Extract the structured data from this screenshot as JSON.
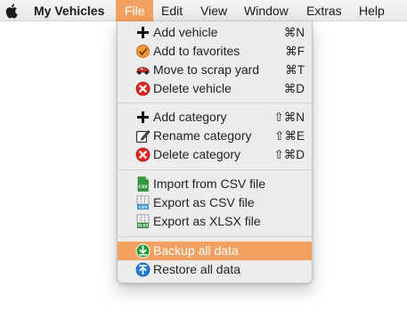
{
  "menubar": {
    "apple_icon": "apple-logo-icon",
    "app_name": "My Vehicles",
    "menus": [
      "File",
      "Edit",
      "View",
      "Window",
      "Extras",
      "Help"
    ],
    "active_menu": "File",
    "highlight_color": "#f3a160"
  },
  "file_menu": {
    "vehicle_group": [
      {
        "label": "Add vehicle",
        "shortcut": "⌘N",
        "icon": "plus-icon"
      },
      {
        "label": "Add to favorites",
        "shortcut": "⌘F",
        "icon": "favorite-check-icon"
      },
      {
        "label": "Move to scrap yard",
        "shortcut": "⌘T",
        "icon": "scrap-car-icon"
      },
      {
        "label": "Delete vehicle",
        "shortcut": "⌘D",
        "icon": "delete-red-icon"
      }
    ],
    "category_group": [
      {
        "label": "Add category",
        "shortcut": "⇧⌘N",
        "icon": "plus-icon"
      },
      {
        "label": "Rename category",
        "shortcut": "⇧⌘E",
        "icon": "rename-pencil-icon"
      },
      {
        "label": "Delete category",
        "shortcut": "⇧⌘D",
        "icon": "delete-red-icon"
      }
    ],
    "file_group": [
      {
        "label": "Import from CSV file",
        "icon": "csv-file-icon",
        "icon_text": "CSV"
      },
      {
        "label": "Export as CSV file",
        "icon": "csv-table-icon",
        "icon_text": "CSV"
      },
      {
        "label": "Export as XLSX file",
        "icon": "xlsx-table-icon",
        "icon_text": "XLSX"
      }
    ],
    "data_group": [
      {
        "label": "Backup all data",
        "icon": "backup-download-icon",
        "highlighted": true
      },
      {
        "label": "Restore all data",
        "icon": "restore-upload-icon"
      }
    ]
  }
}
